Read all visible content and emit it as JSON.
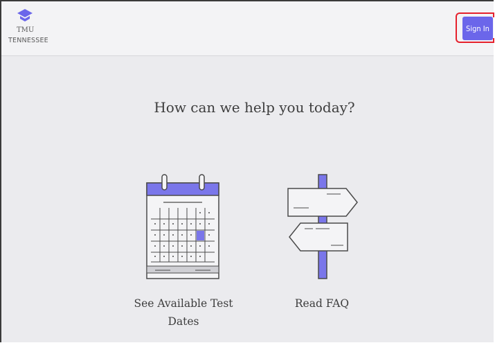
{
  "header": {
    "logo_title": "TMU",
    "logo_subtitle": "TENNESSEE",
    "sign_in_label": "Sign In"
  },
  "main": {
    "headline": "How can we help you today?",
    "cards": [
      {
        "label": "See Available Test Dates",
        "icon": "calendar-icon"
      },
      {
        "label": "Read FAQ",
        "icon": "signpost-icon"
      }
    ]
  },
  "colors": {
    "accent": "#6b66ea",
    "page_background": "#ebebee",
    "header_background": "#f3f3f5",
    "highlight_red": "#e5202c"
  }
}
